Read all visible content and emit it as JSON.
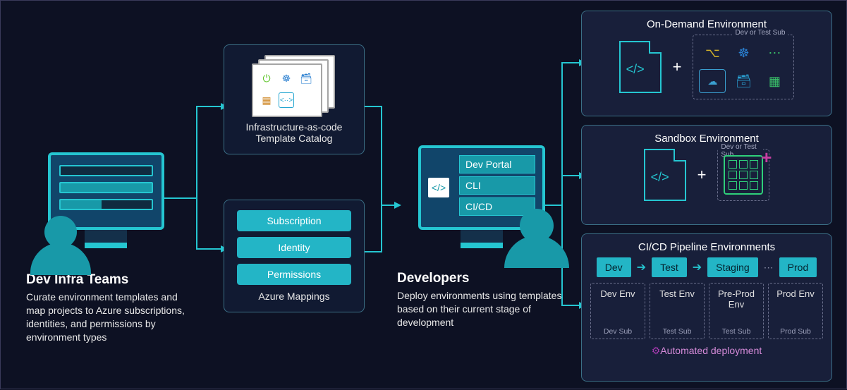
{
  "dev_infra": {
    "title": "Dev Infra Teams",
    "desc": "Curate environment templates and map projects to Azure subscriptions, identities, and permissions by environment types"
  },
  "iac": {
    "title": "Infrastructure-as-code Template Catalog",
    "icons": [
      "power-icon",
      "kubernetes-icon",
      "database-icon",
      "arm-template-icon",
      "code-icon"
    ]
  },
  "mappings": {
    "title": "Azure Mappings",
    "items": [
      "Subscription",
      "Identity",
      "Permissions"
    ]
  },
  "developers": {
    "title": "Developers",
    "desc": "Deploy environments using templates based on their current stage of development",
    "options": [
      "Dev Portal",
      "CLI",
      "CI/CD"
    ]
  },
  "on_demand": {
    "title": "On-Demand Environment",
    "sub_label": "Dev or Test Sub",
    "services": [
      "git-icon",
      "kubernetes-icon",
      "more-icon",
      "cloud-app-icon",
      "database-bolt-icon",
      "app-grid-icon"
    ]
  },
  "sandbox": {
    "title": "Sandbox Environment",
    "sub_label": "Dev or Test Sub"
  },
  "pipeline": {
    "title": "CI/CD Pipeline Environments",
    "stages": [
      "Dev",
      "Test",
      "Staging",
      "Prod"
    ],
    "envs": [
      {
        "name": "Dev Env",
        "sub": "Dev Sub"
      },
      {
        "name": "Test Env",
        "sub": "Test Sub"
      },
      {
        "name": "Pre-Prod Env",
        "sub": "Test Sub"
      },
      {
        "name": "Prod Env",
        "sub": "Prod Sub"
      }
    ],
    "automated": "Automated deployment"
  }
}
